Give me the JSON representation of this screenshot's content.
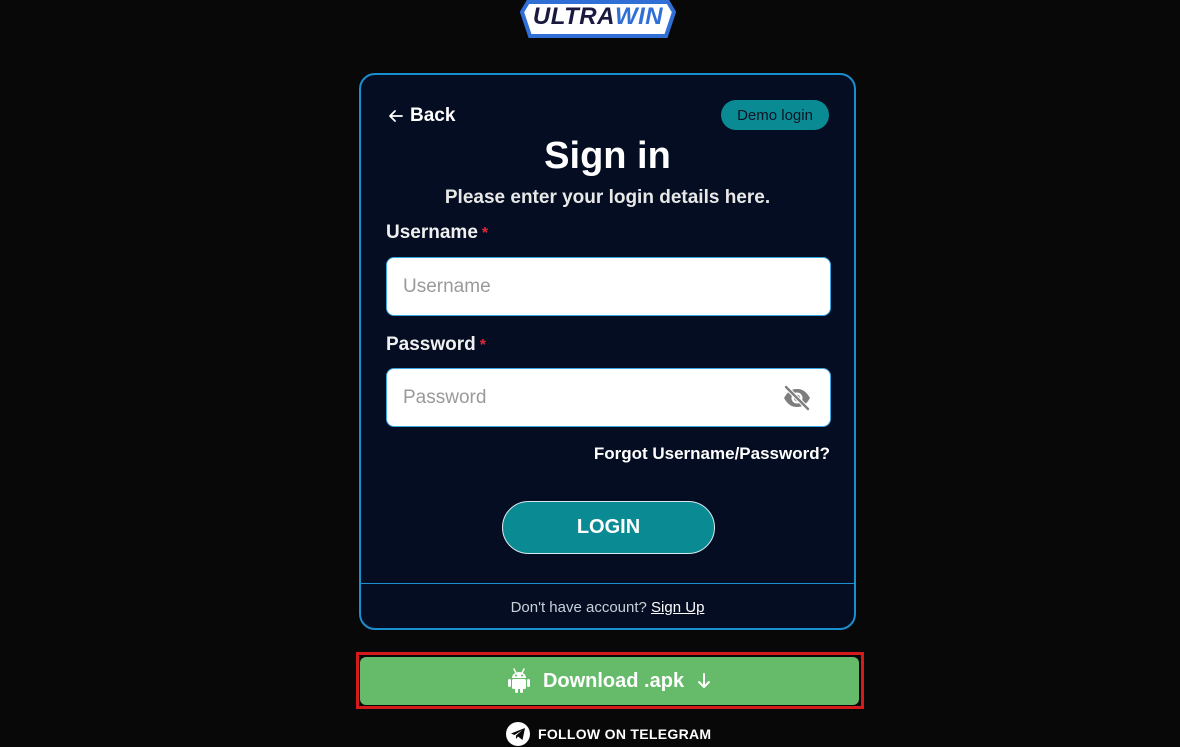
{
  "logo": {
    "part1": "ULTRA",
    "part2": "WIN"
  },
  "card": {
    "back_label": "Back",
    "demo_label": "Demo login",
    "title": "Sign in",
    "subtitle": "Please enter your login details here.",
    "username": {
      "label": "Username",
      "required_mark": "*",
      "placeholder": "Username",
      "value": ""
    },
    "password": {
      "label": "Password",
      "required_mark": "*",
      "placeholder": "Password",
      "value": ""
    },
    "forgot_label": "Forgot Username/Password?",
    "login_label": "LOGIN",
    "signup_prompt": "Don't have account?",
    "signup_link": "Sign Up"
  },
  "download": {
    "label": "Download .apk"
  },
  "telegram": {
    "label": "FOLLOW ON TELEGRAM"
  },
  "colors": {
    "background": "#080808",
    "card_bg": "#050d22",
    "card_border": "#1a8fd0",
    "teal": "#0a8b94",
    "download_green": "#66bb6a",
    "highlight_red": "#d41a1a",
    "required_red": "#e0283a"
  },
  "icons": {
    "back": "arrow-left-icon",
    "eye": "eye-off-icon",
    "android": "android-icon",
    "download": "arrow-down-icon",
    "telegram": "telegram-icon"
  }
}
